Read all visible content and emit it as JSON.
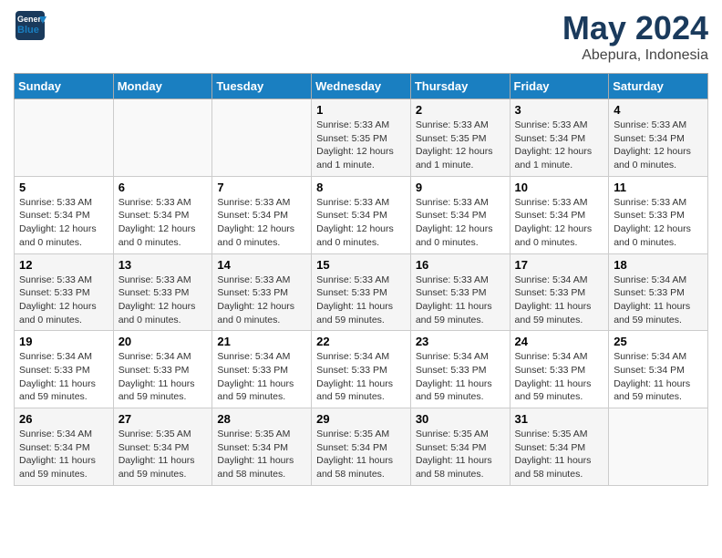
{
  "header": {
    "logo_line1": "General",
    "logo_line2": "Blue",
    "month": "May 2024",
    "location": "Abepura, Indonesia"
  },
  "weekdays": [
    "Sunday",
    "Monday",
    "Tuesday",
    "Wednesday",
    "Thursday",
    "Friday",
    "Saturday"
  ],
  "weeks": [
    [
      {
        "day": "",
        "info": ""
      },
      {
        "day": "",
        "info": ""
      },
      {
        "day": "",
        "info": ""
      },
      {
        "day": "1",
        "info": "Sunrise: 5:33 AM\nSunset: 5:35 PM\nDaylight: 12 hours and 1 minute."
      },
      {
        "day": "2",
        "info": "Sunrise: 5:33 AM\nSunset: 5:35 PM\nDaylight: 12 hours and 1 minute."
      },
      {
        "day": "3",
        "info": "Sunrise: 5:33 AM\nSunset: 5:34 PM\nDaylight: 12 hours and 1 minute."
      },
      {
        "day": "4",
        "info": "Sunrise: 5:33 AM\nSunset: 5:34 PM\nDaylight: 12 hours and 0 minutes."
      }
    ],
    [
      {
        "day": "5",
        "info": "Sunrise: 5:33 AM\nSunset: 5:34 PM\nDaylight: 12 hours and 0 minutes."
      },
      {
        "day": "6",
        "info": "Sunrise: 5:33 AM\nSunset: 5:34 PM\nDaylight: 12 hours and 0 minutes."
      },
      {
        "day": "7",
        "info": "Sunrise: 5:33 AM\nSunset: 5:34 PM\nDaylight: 12 hours and 0 minutes."
      },
      {
        "day": "8",
        "info": "Sunrise: 5:33 AM\nSunset: 5:34 PM\nDaylight: 12 hours and 0 minutes."
      },
      {
        "day": "9",
        "info": "Sunrise: 5:33 AM\nSunset: 5:34 PM\nDaylight: 12 hours and 0 minutes."
      },
      {
        "day": "10",
        "info": "Sunrise: 5:33 AM\nSunset: 5:34 PM\nDaylight: 12 hours and 0 minutes."
      },
      {
        "day": "11",
        "info": "Sunrise: 5:33 AM\nSunset: 5:33 PM\nDaylight: 12 hours and 0 minutes."
      }
    ],
    [
      {
        "day": "12",
        "info": "Sunrise: 5:33 AM\nSunset: 5:33 PM\nDaylight: 12 hours and 0 minutes."
      },
      {
        "day": "13",
        "info": "Sunrise: 5:33 AM\nSunset: 5:33 PM\nDaylight: 12 hours and 0 minutes."
      },
      {
        "day": "14",
        "info": "Sunrise: 5:33 AM\nSunset: 5:33 PM\nDaylight: 12 hours and 0 minutes."
      },
      {
        "day": "15",
        "info": "Sunrise: 5:33 AM\nSunset: 5:33 PM\nDaylight: 11 hours and 59 minutes."
      },
      {
        "day": "16",
        "info": "Sunrise: 5:33 AM\nSunset: 5:33 PM\nDaylight: 11 hours and 59 minutes."
      },
      {
        "day": "17",
        "info": "Sunrise: 5:34 AM\nSunset: 5:33 PM\nDaylight: 11 hours and 59 minutes."
      },
      {
        "day": "18",
        "info": "Sunrise: 5:34 AM\nSunset: 5:33 PM\nDaylight: 11 hours and 59 minutes."
      }
    ],
    [
      {
        "day": "19",
        "info": "Sunrise: 5:34 AM\nSunset: 5:33 PM\nDaylight: 11 hours and 59 minutes."
      },
      {
        "day": "20",
        "info": "Sunrise: 5:34 AM\nSunset: 5:33 PM\nDaylight: 11 hours and 59 minutes."
      },
      {
        "day": "21",
        "info": "Sunrise: 5:34 AM\nSunset: 5:33 PM\nDaylight: 11 hours and 59 minutes."
      },
      {
        "day": "22",
        "info": "Sunrise: 5:34 AM\nSunset: 5:33 PM\nDaylight: 11 hours and 59 minutes."
      },
      {
        "day": "23",
        "info": "Sunrise: 5:34 AM\nSunset: 5:33 PM\nDaylight: 11 hours and 59 minutes."
      },
      {
        "day": "24",
        "info": "Sunrise: 5:34 AM\nSunset: 5:33 PM\nDaylight: 11 hours and 59 minutes."
      },
      {
        "day": "25",
        "info": "Sunrise: 5:34 AM\nSunset: 5:34 PM\nDaylight: 11 hours and 59 minutes."
      }
    ],
    [
      {
        "day": "26",
        "info": "Sunrise: 5:34 AM\nSunset: 5:34 PM\nDaylight: 11 hours and 59 minutes."
      },
      {
        "day": "27",
        "info": "Sunrise: 5:35 AM\nSunset: 5:34 PM\nDaylight: 11 hours and 59 minutes."
      },
      {
        "day": "28",
        "info": "Sunrise: 5:35 AM\nSunset: 5:34 PM\nDaylight: 11 hours and 58 minutes."
      },
      {
        "day": "29",
        "info": "Sunrise: 5:35 AM\nSunset: 5:34 PM\nDaylight: 11 hours and 58 minutes."
      },
      {
        "day": "30",
        "info": "Sunrise: 5:35 AM\nSunset: 5:34 PM\nDaylight: 11 hours and 58 minutes."
      },
      {
        "day": "31",
        "info": "Sunrise: 5:35 AM\nSunset: 5:34 PM\nDaylight: 11 hours and 58 minutes."
      },
      {
        "day": "",
        "info": ""
      }
    ]
  ]
}
